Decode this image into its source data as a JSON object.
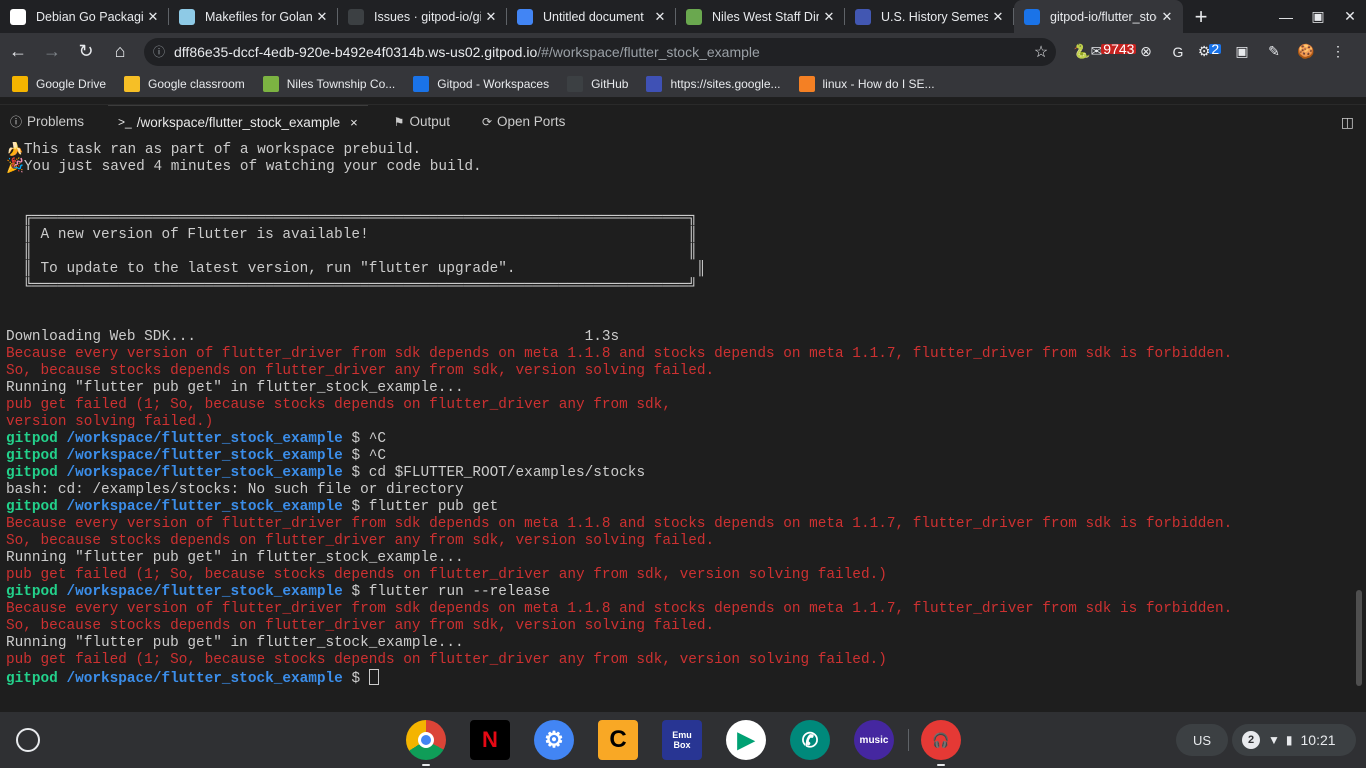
{
  "tabs": [
    {
      "title": "Debian Go Packaging",
      "icon": "debian-icon",
      "color": "#ffffff"
    },
    {
      "title": "Makefiles for Golang",
      "icon": "gopher-icon",
      "color": "#8ecae6"
    },
    {
      "title": "Issues · gitpod-io/gitpod",
      "icon": "github-icon",
      "color": "#3c4043"
    },
    {
      "title": "Untitled document",
      "icon": "docs-icon",
      "color": "#4285f4"
    },
    {
      "title": "Niles West Staff Directory",
      "icon": "niles-icon",
      "color": "#6aa84f"
    },
    {
      "title": "U.S. History Semester",
      "icon": "quizlet-icon",
      "color": "#4257b2"
    },
    {
      "title": "gitpod-io/flutter_stock_example",
      "icon": "gitpod-icon",
      "color": "#1a73e8",
      "active": true
    }
  ],
  "new_tab_label": "+",
  "window_controls": {
    "minimize": "—",
    "maximize": "▣",
    "close": "✕"
  },
  "omnibox": {
    "host": "dff86e35-dccf-4edb-920e-b492e4f0314b.ws-us02.gitpod.io",
    "path": "/#/workspace/flutter_stock_example"
  },
  "extensions": [
    {
      "name": "python-icon",
      "glyph": "🐍"
    },
    {
      "name": "mail-icon",
      "glyph": "✉",
      "badge": "9743"
    },
    {
      "name": "blocker-icon",
      "glyph": "⊗"
    },
    {
      "name": "grammarly-icon",
      "glyph": "G"
    },
    {
      "name": "extension-icon",
      "glyph": "⚙",
      "badge": "2"
    },
    {
      "name": "screen-icon",
      "glyph": "▣"
    },
    {
      "name": "pen-icon",
      "glyph": "✎"
    },
    {
      "name": "cookie-icon",
      "glyph": "🍪"
    },
    {
      "name": "menu-icon",
      "glyph": "⋮"
    }
  ],
  "bookmarks": [
    {
      "label": "Google Drive",
      "icon": "drive-icon",
      "color": "#f4b400"
    },
    {
      "label": "Google classroom",
      "icon": "classroom-icon",
      "color": "#f6bf26"
    },
    {
      "label": "Niles Township Co...",
      "icon": "niles-township-icon",
      "color": "#7cb342"
    },
    {
      "label": "Gitpod - Workspaces",
      "icon": "gitpod-icon",
      "color": "#1a73e8"
    },
    {
      "label": "GitHub",
      "icon": "github-icon",
      "color": "#3c4043"
    },
    {
      "label": "https://sites.google...",
      "icon": "sites-icon",
      "color": "#3f51b5"
    },
    {
      "label": "linux - How do I SE...",
      "icon": "stackoverflow-icon",
      "color": "#f48024"
    }
  ],
  "panel": {
    "tabs": [
      {
        "label": "Problems",
        "icon": "ⓘ"
      },
      {
        "label": "/workspace/flutter_stock_example",
        "icon": ">_",
        "active": true
      },
      {
        "label": "Output",
        "icon": "⚑"
      },
      {
        "label": "Open Ports",
        "icon": "⟳"
      }
    ],
    "close_glyph": "×",
    "maximize_glyph": "◫"
  },
  "terminal": {
    "lines": [
      {
        "type": "plain",
        "text": "🍌This task ran as part of a workspace prebuild."
      },
      {
        "type": "plain",
        "text": "🎉You just saved 4 minutes of watching your code build."
      },
      {
        "type": "plain",
        "text": ""
      },
      {
        "type": "plain",
        "text": ""
      },
      {
        "type": "plain",
        "text": "  ╔════════════════════════════════════════════════════════════════════════════╗"
      },
      {
        "type": "plain",
        "text": "  ║ A new version of Flutter is available!                                     ║"
      },
      {
        "type": "plain",
        "text": "  ║                                                                            ║"
      },
      {
        "type": "plain",
        "text": "  ║ To update to the latest version, run \"flutter upgrade\".                     ║"
      },
      {
        "type": "plain",
        "text": "  ╚════════════════════════════════════════════════════════════════════════════╝"
      },
      {
        "type": "plain",
        "text": ""
      },
      {
        "type": "plain",
        "text": ""
      },
      {
        "type": "plain",
        "text": "Downloading Web SDK...                                             1.3s"
      },
      {
        "type": "error",
        "text": "Because every version of flutter_driver from sdk depends on meta 1.1.8 and stocks depends on meta 1.1.7, flutter_driver from sdk is forbidden."
      },
      {
        "type": "error",
        "text": "So, because stocks depends on flutter_driver any from sdk, version solving failed."
      },
      {
        "type": "plain",
        "text": "Running \"flutter pub get\" in flutter_stock_example..."
      },
      {
        "type": "error",
        "text": "pub get failed (1; So, because stocks depends on flutter_driver any from sdk,"
      },
      {
        "type": "error",
        "text": "version solving failed.)"
      },
      {
        "type": "prompt",
        "user": "gitpod",
        "dir": "/workspace/flutter_stock_example",
        "cmd": " $ ^C"
      },
      {
        "type": "prompt",
        "user": "gitpod",
        "dir": "/workspace/flutter_stock_example",
        "cmd": " $ ^C"
      },
      {
        "type": "prompt",
        "user": "gitpod",
        "dir": "/workspace/flutter_stock_example",
        "cmd": " $ cd $FLUTTER_ROOT/examples/stocks"
      },
      {
        "type": "plain",
        "text": "bash: cd: /examples/stocks: No such file or directory"
      },
      {
        "type": "prompt",
        "user": "gitpod",
        "dir": "/workspace/flutter_stock_example",
        "cmd": " $ flutter pub get"
      },
      {
        "type": "error",
        "text": "Because every version of flutter_driver from sdk depends on meta 1.1.8 and stocks depends on meta 1.1.7, flutter_driver from sdk is forbidden."
      },
      {
        "type": "error",
        "text": "So, because stocks depends on flutter_driver any from sdk, version solving failed."
      },
      {
        "type": "plain",
        "text": "Running \"flutter pub get\" in flutter_stock_example..."
      },
      {
        "type": "error",
        "text": "pub get failed (1; So, because stocks depends on flutter_driver any from sdk, version solving failed.)"
      },
      {
        "type": "prompt",
        "user": "gitpod",
        "dir": "/workspace/flutter_stock_example",
        "cmd": " $ flutter run --release"
      },
      {
        "type": "error",
        "text": "Because every version of flutter_driver from sdk depends on meta 1.1.8 and stocks depends on meta 1.1.7, flutter_driver from sdk is forbidden."
      },
      {
        "type": "error",
        "text": "So, because stocks depends on flutter_driver any from sdk, version solving failed."
      },
      {
        "type": "plain",
        "text": "Running \"flutter pub get\" in flutter_stock_example..."
      },
      {
        "type": "error",
        "text": "pub get failed (1; So, because stocks depends on flutter_driver any from sdk, version solving failed.)"
      },
      {
        "type": "prompt",
        "user": "gitpod",
        "dir": "/workspace/flutter_stock_example",
        "cmd": " $ ",
        "cursor": true
      }
    ]
  },
  "shelf": {
    "apps": [
      {
        "name": "chrome-app",
        "label": "",
        "color": "#ffffff",
        "running": true
      },
      {
        "name": "netflix-app",
        "label": "N",
        "color": "#000000"
      },
      {
        "name": "settings-app",
        "label": "⚙",
        "color": "#4285f4"
      },
      {
        "name": "c-app",
        "label": "C",
        "color": "#f9a825"
      },
      {
        "name": "emubox-app",
        "label": "Emu Box",
        "color": "#283593"
      },
      {
        "name": "play-store-app",
        "label": "▶",
        "color": "#ffffff"
      },
      {
        "name": "phone-app",
        "label": "✆",
        "color": "#00897b"
      },
      {
        "name": "amazon-music-app",
        "label": "music",
        "color": "#4527a0"
      },
      {
        "name": "headphones-app",
        "label": "🎧",
        "color": "#e53935",
        "running": true
      }
    ],
    "ime": "US",
    "notifications": "2",
    "time": "10:21"
  }
}
